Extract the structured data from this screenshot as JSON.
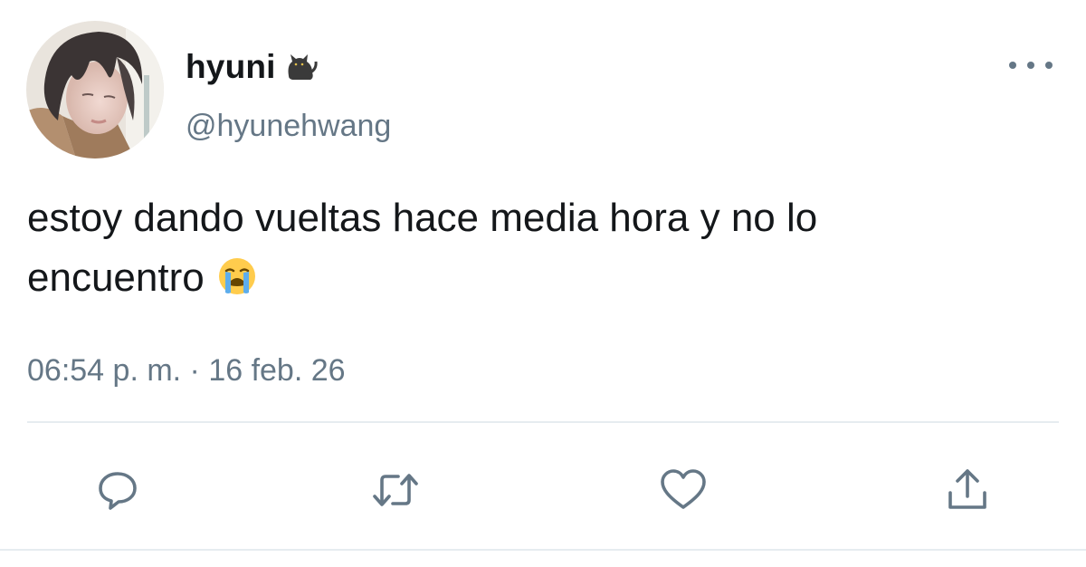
{
  "author": {
    "display_name": "hyuni",
    "name_emoji": "cat-emoji",
    "handle": "@hyunehwang"
  },
  "tweet": {
    "text_line_1": "estoy dando vueltas hace media hora y no lo",
    "text_line_2": "encuentro",
    "text_emoji": "loudly-crying-face-emoji",
    "timestamp": "06:54 p. m. · 16 feb. 26"
  },
  "icons": {
    "more": "more-horizontal-icon",
    "reply": "reply-icon",
    "retweet": "retweet-icon",
    "like": "heart-icon",
    "share": "share-icon"
  },
  "colors": {
    "text_primary": "#14171a",
    "text_secondary": "#657786",
    "divider": "#e6ecf0",
    "icon": "#657786"
  }
}
